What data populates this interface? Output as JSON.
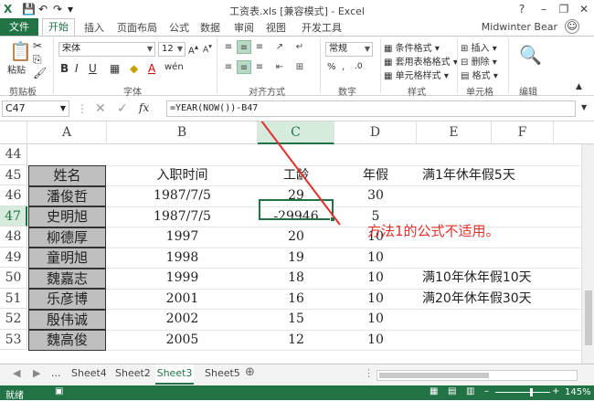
{
  "title_bar": {
    "title": "工资表.xls  [兼容模式] - Excel",
    "help": "?",
    "minimize": "–",
    "restore": "❐",
    "close": "✕"
  },
  "tabs": {
    "file": "文件",
    "home": "开始",
    "insert": "插入",
    "layout": "页面布局",
    "formulas": "公式",
    "data": "数据",
    "review": "审阅",
    "view": "视图",
    "developer": "开发工具",
    "user": "Midwinter Bear"
  },
  "ribbon": {
    "paste": "粘贴",
    "clipboard": "剪贴板",
    "font_name": "宋体",
    "font_size": "12",
    "font_group": "字体",
    "align_group": "对齐方式",
    "number_format": "常规",
    "number_group": "数字",
    "cond_format": "条件格式",
    "table_format": "套用表格格式",
    "cell_styles": "单元格样式",
    "styles_group": "样式",
    "insert": "插入",
    "delete": "删除",
    "format": "格式",
    "cells_group": "单元格",
    "edit_group": "编辑",
    "bold": "B",
    "italic": "I",
    "underline": "U"
  },
  "formula_bar": {
    "name_box": "C47",
    "formula": "=YEAR(NOW())-B47",
    "fx": "fx"
  },
  "columns": [
    "A",
    "B",
    "C",
    "D",
    "E",
    "F"
  ],
  "rows": [
    {
      "num": "44",
      "name": "",
      "date": "",
      "years": "",
      "leave": "",
      "note": ""
    },
    {
      "num": "45",
      "name": "姓名",
      "date": "入职时间",
      "years": "工龄",
      "leave": "年假",
      "note": "满1年休年假5天"
    },
    {
      "num": "46",
      "name": "潘俊哲",
      "date": "1987/7/5",
      "years": "29",
      "leave": "30",
      "note": ""
    },
    {
      "num": "47",
      "name": "史明旭",
      "date": "1987/7/5",
      "years": "-29946",
      "leave": "5",
      "note": ""
    },
    {
      "num": "48",
      "name": "柳德厚",
      "date": "1997",
      "years": "20",
      "leave": "10",
      "note": ""
    },
    {
      "num": "49",
      "name": "童明旭",
      "date": "1998",
      "years": "19",
      "leave": "10",
      "note": ""
    },
    {
      "num": "50",
      "name": "魏嘉志",
      "date": "1999",
      "years": "18",
      "leave": "10",
      "note": "满10年休年假10天"
    },
    {
      "num": "51",
      "name": "乐彦博",
      "date": "2001",
      "years": "16",
      "leave": "10",
      "note": "满20年休年假30天"
    },
    {
      "num": "52",
      "name": "殷伟诚",
      "date": "2002",
      "years": "15",
      "leave": "10",
      "note": ""
    },
    {
      "num": "53",
      "name": "魏高俊",
      "date": "2005",
      "years": "12",
      "leave": "10",
      "note": ""
    }
  ],
  "annotation": "方法1的公式不适用。",
  "sheets": {
    "more": "...",
    "s4": "Sheet4",
    "s2": "Sheet2",
    "s3": "Sheet3",
    "s5": "Sheet5",
    "add": "⊕"
  },
  "status": {
    "ready": "就绪",
    "zoom": "145%"
  },
  "colors": {
    "accent": "#217346",
    "annotation": "#e0302a"
  }
}
